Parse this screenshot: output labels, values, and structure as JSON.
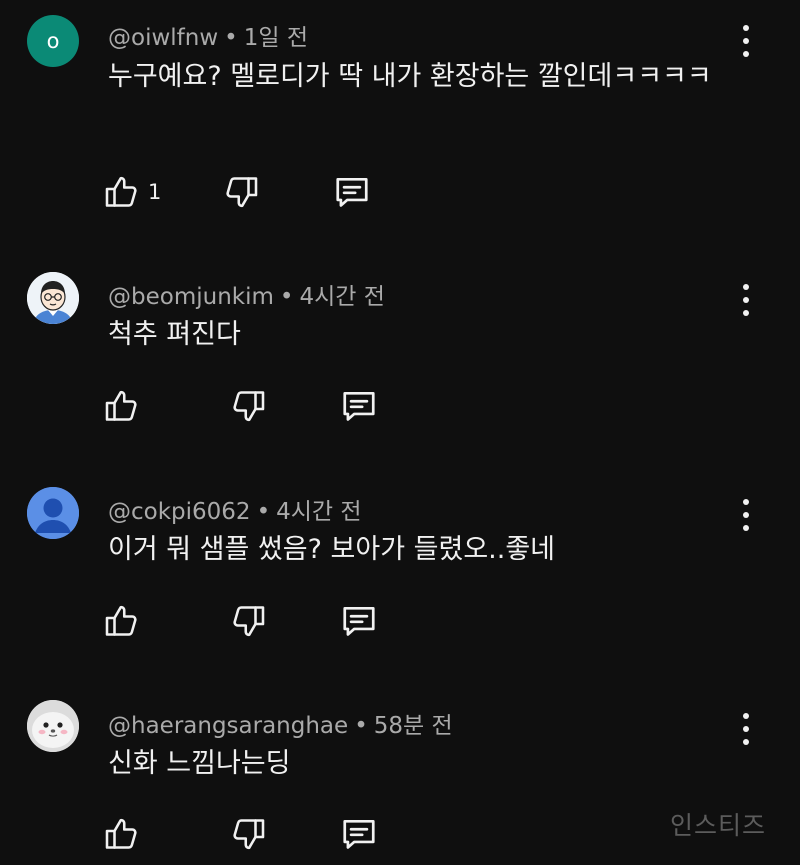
{
  "comments": [
    {
      "avatar_letter": "o",
      "avatar_color": "#0b8a76",
      "username": "@oiwlfnw",
      "time": "1일 전",
      "text": "누구예요? 멜로디가 딱 내가 환장하는 깔인데ㅋㅋㅋㅋ",
      "likes": "1"
    },
    {
      "username": "@beomjunkim",
      "time": "4시간 전",
      "text": "척추 펴진다",
      "likes": ""
    },
    {
      "username": "@cokpi6062",
      "time": "4시간 전",
      "text": "이거 뭐 샘플 썼음? 보아가 들렸오..좋네",
      "likes": ""
    },
    {
      "username": "@haerangsaranghae",
      "time": "58분 전",
      "text": "신화 느낌나는딩",
      "likes": ""
    }
  ],
  "meta_separator": "•",
  "watermark": "인스티즈"
}
